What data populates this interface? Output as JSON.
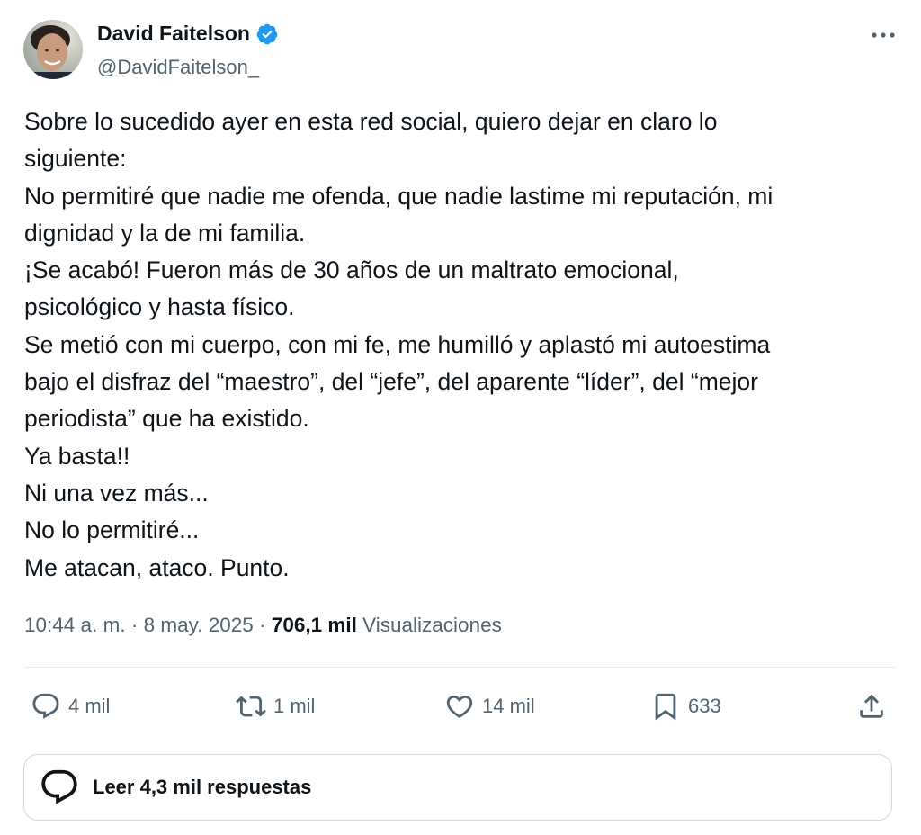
{
  "author": {
    "display_name": "David Faitelson",
    "handle": "@DavidFaitelson_",
    "verified_icon": "verified-badge-icon",
    "verified_color": "#1d9bf0"
  },
  "tweet": {
    "lines": [
      "Sobre lo sucedido ayer en esta red social, quiero dejar en claro lo",
      "siguiente:",
      "No permitiré que nadie me ofenda, que nadie lastime mi reputación, mi",
      "dignidad y la de mi familia.",
      "¡Se acabó! Fueron más de 30 años de un maltrato emocional,",
      "psicológico y hasta físico.",
      "Se metió con mi cuerpo, con mi fe, me humilló y aplastó mi autoestima",
      "bajo el disfraz del “maestro”, del “jefe”, del aparente “líder”, del “mejor",
      "periodista” que ha existido.",
      "Ya basta!!",
      "Ni una vez más...",
      "No lo permitiré...",
      "Me atacan, ataco. Punto."
    ]
  },
  "meta": {
    "time": "10:44 a. m.",
    "separator": "·",
    "date": "8 may. 2025",
    "views_count": "706,1 mil",
    "views_label": "Visualizaciones"
  },
  "actions": {
    "reply": {
      "icon": "reply-icon",
      "count": "4 mil"
    },
    "retweet": {
      "icon": "retweet-icon",
      "count": "1 mil"
    },
    "like": {
      "icon": "heart-icon",
      "count": "14 mil"
    },
    "bookmark": {
      "icon": "bookmark-icon",
      "count": "633"
    },
    "share": {
      "icon": "share-icon"
    }
  },
  "read_replies": {
    "icon": "chat-bubble-icon",
    "label": "Leer 4,3 mil respuestas"
  },
  "colors": {
    "text": "#0f1419",
    "secondary": "#536471",
    "border": "#cfd9de",
    "accent": "#1d9bf0"
  }
}
